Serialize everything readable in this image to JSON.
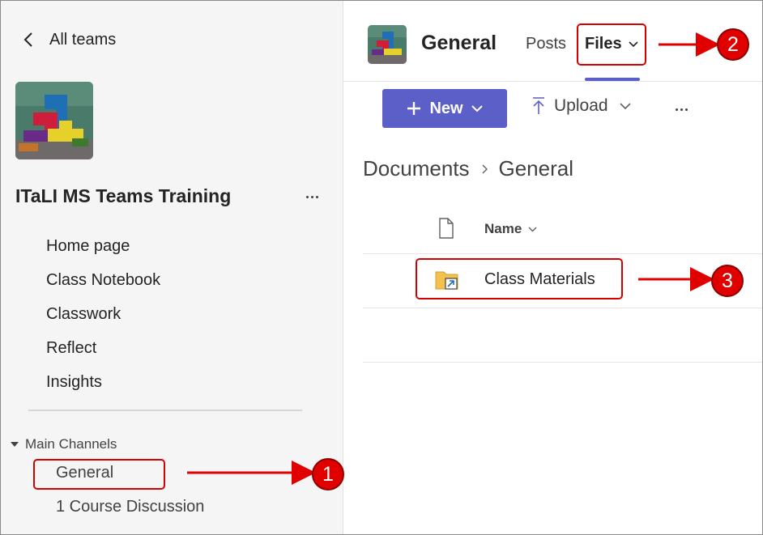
{
  "sidebar": {
    "back_label": "All teams",
    "team_name": "ITaLI MS Teams Training",
    "nav_items": [
      "Home page",
      "Class Notebook",
      "Classwork",
      "Reflect",
      "Insights"
    ],
    "section_label": "Main Channels",
    "channels": [
      "General",
      "1 Course Discussion"
    ]
  },
  "header": {
    "channel_title": "General",
    "tabs": {
      "posts": "Posts",
      "files": "Files"
    }
  },
  "toolbar": {
    "new_label": "New",
    "upload_label": "Upload"
  },
  "breadcrumb": {
    "root": "Documents",
    "current": "General"
  },
  "file_list": {
    "name_header": "Name",
    "rows": [
      {
        "name": "Class Materials"
      }
    ]
  },
  "callouts": [
    "1",
    "2",
    "3"
  ],
  "colors": {
    "accent": "#5b5fc7",
    "annotation": "#e00000"
  }
}
